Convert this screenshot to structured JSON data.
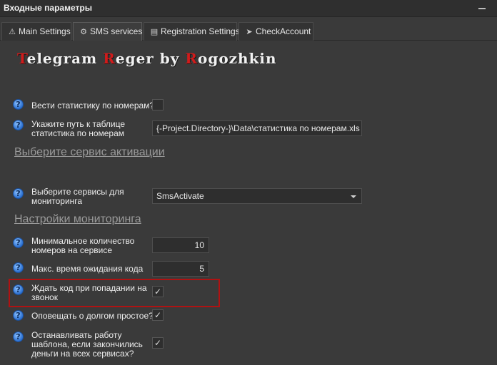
{
  "window": {
    "title": "Входные параметры"
  },
  "tabs": [
    {
      "label": "Main Settings",
      "icon": "warning-icon"
    },
    {
      "label": "SMS services",
      "icon": "gear-icon"
    },
    {
      "label": "Registration Settings",
      "icon": "document-icon"
    },
    {
      "label": "CheckAccount",
      "icon": "send-icon"
    }
  ],
  "brand": {
    "t1": "T",
    "t1rest": "elegram ",
    "t2": "R",
    "t2rest": "eger by ",
    "t3": "R",
    "t3rest": "ogozhkin",
    "accent": "#d11b1b"
  },
  "settings": {
    "stats_label": "Вести статистику по номерам?",
    "stats_checked": false,
    "path_label_1": "Укажите путь к таблице",
    "path_label_2": "статистика по номерам",
    "path_value": "{-Project.Directory-}\\Data\\статистика по номерам.xls",
    "path_button": "···",
    "section_activation": "Выберите сервис активации",
    "services_label_1": "Выберите сервисы для",
    "services_label_2": "мониторинга",
    "services_value": "SmsActivate",
    "section_monitoring": "Настройки мониторинга",
    "min_label_1": "Минимальное количество",
    "min_label_2": "номеров на сервисе",
    "min_value": "10",
    "wait_label": "Макс. время ожидания кода",
    "wait_value": "5",
    "call_label_1": "Ждать код при попадании на",
    "call_label_2": "звонок",
    "call_checked": true,
    "notify_label": "Оповещать о долгом простое?",
    "notify_checked": true,
    "stop_label_1": "Останавливать работу",
    "stop_label_2": "шаблона, если закончились",
    "stop_label_3": "деньги на всех сервисах?",
    "stop_checked": true,
    "check_mark": "✓",
    "help_mark": "?"
  }
}
